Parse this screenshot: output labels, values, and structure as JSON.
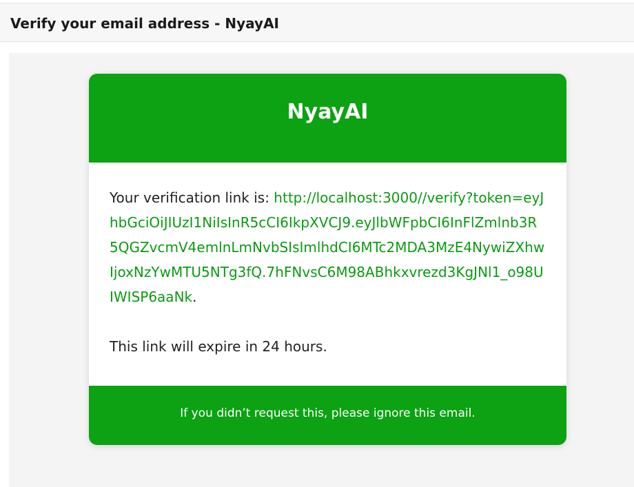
{
  "email": {
    "subject": "Verify your email address - NyayAI"
  },
  "card": {
    "brand": "NyayAI",
    "intro": "Your verification link is: ",
    "verify_link": "http://localhost:3000//verify?token=eyJhbGciOiJIUzI1NiIsInR5cCI6IkpXVCJ9.eyJlbWFpbCI6InFlZmlnb3R5QGZvcmV4emlnLmNvbSIsImlhdCI6MTc2MDA3MzE4NywiZXhwIjoxNzYwMTU5NTg3fQ.7hFNvsC6M98ABhkxvrezd3KgJNl1_o98UIWISP6aaNk",
    "period": ".",
    "expiry": "This link will expire in 24 hours.",
    "footer": "If you didn’t request this, please ignore this email."
  },
  "colors": {
    "brand_green": "#0ca213",
    "link_green": "#0a9a12"
  }
}
